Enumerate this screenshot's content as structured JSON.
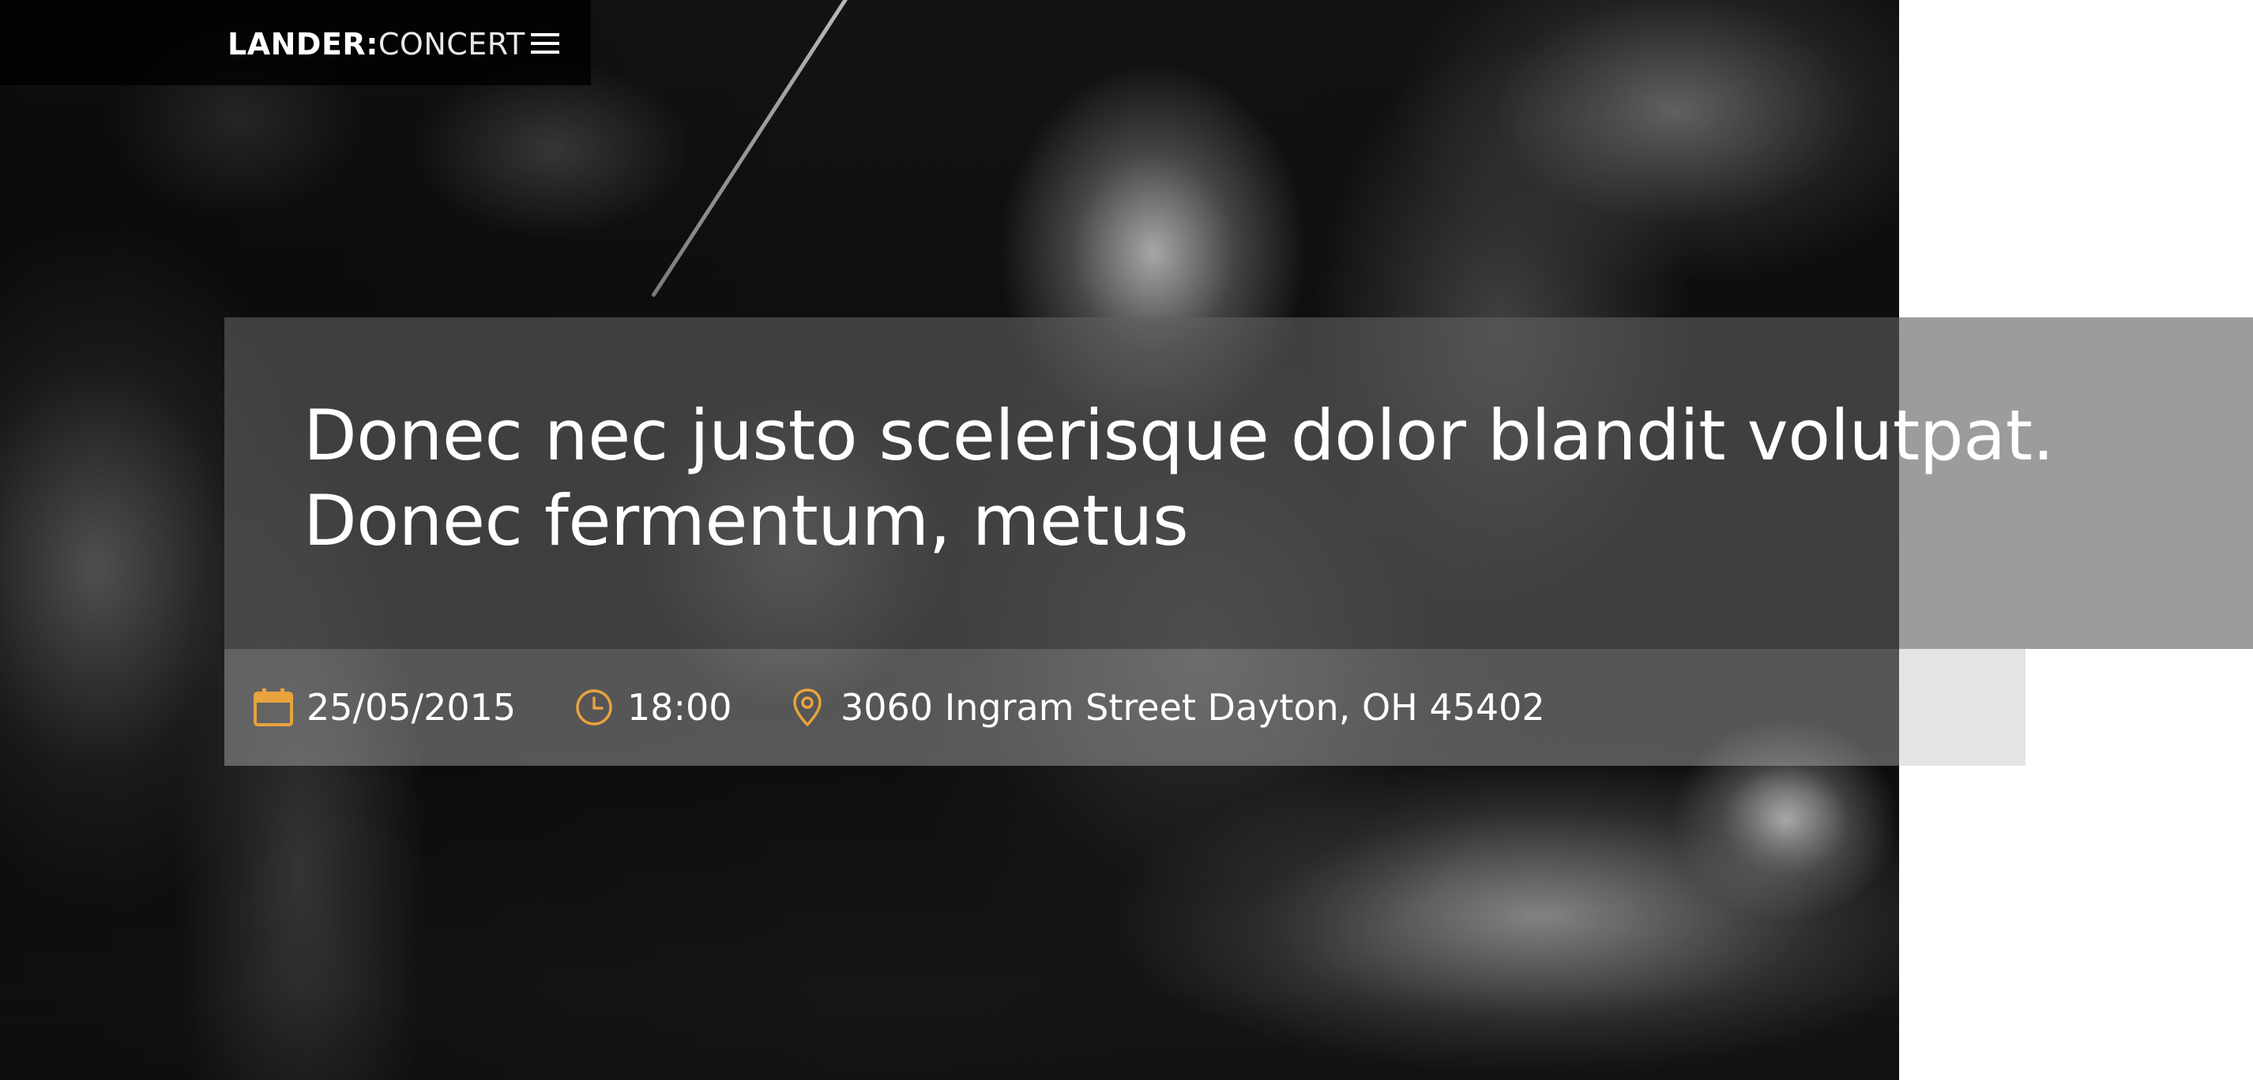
{
  "header": {
    "brand_strong": "LANDER:",
    "brand_light": "CONCERT",
    "menu_icon": "hamburger-menu-icon"
  },
  "hero": {
    "title": "Donec nec justo scelerisque dolor blandit volutpat. Donec fermentum, metus"
  },
  "event": {
    "date": "25/05/2015",
    "time": "18:00",
    "address": "3060 Ingram Street Dayton, OH 45402",
    "icons": {
      "date": "calendar-icon",
      "time": "clock-icon",
      "address": "map-pin-icon"
    }
  },
  "colors": {
    "accent": "#E8A33D",
    "text": "#FFFFFF",
    "topbar": "#000000"
  }
}
